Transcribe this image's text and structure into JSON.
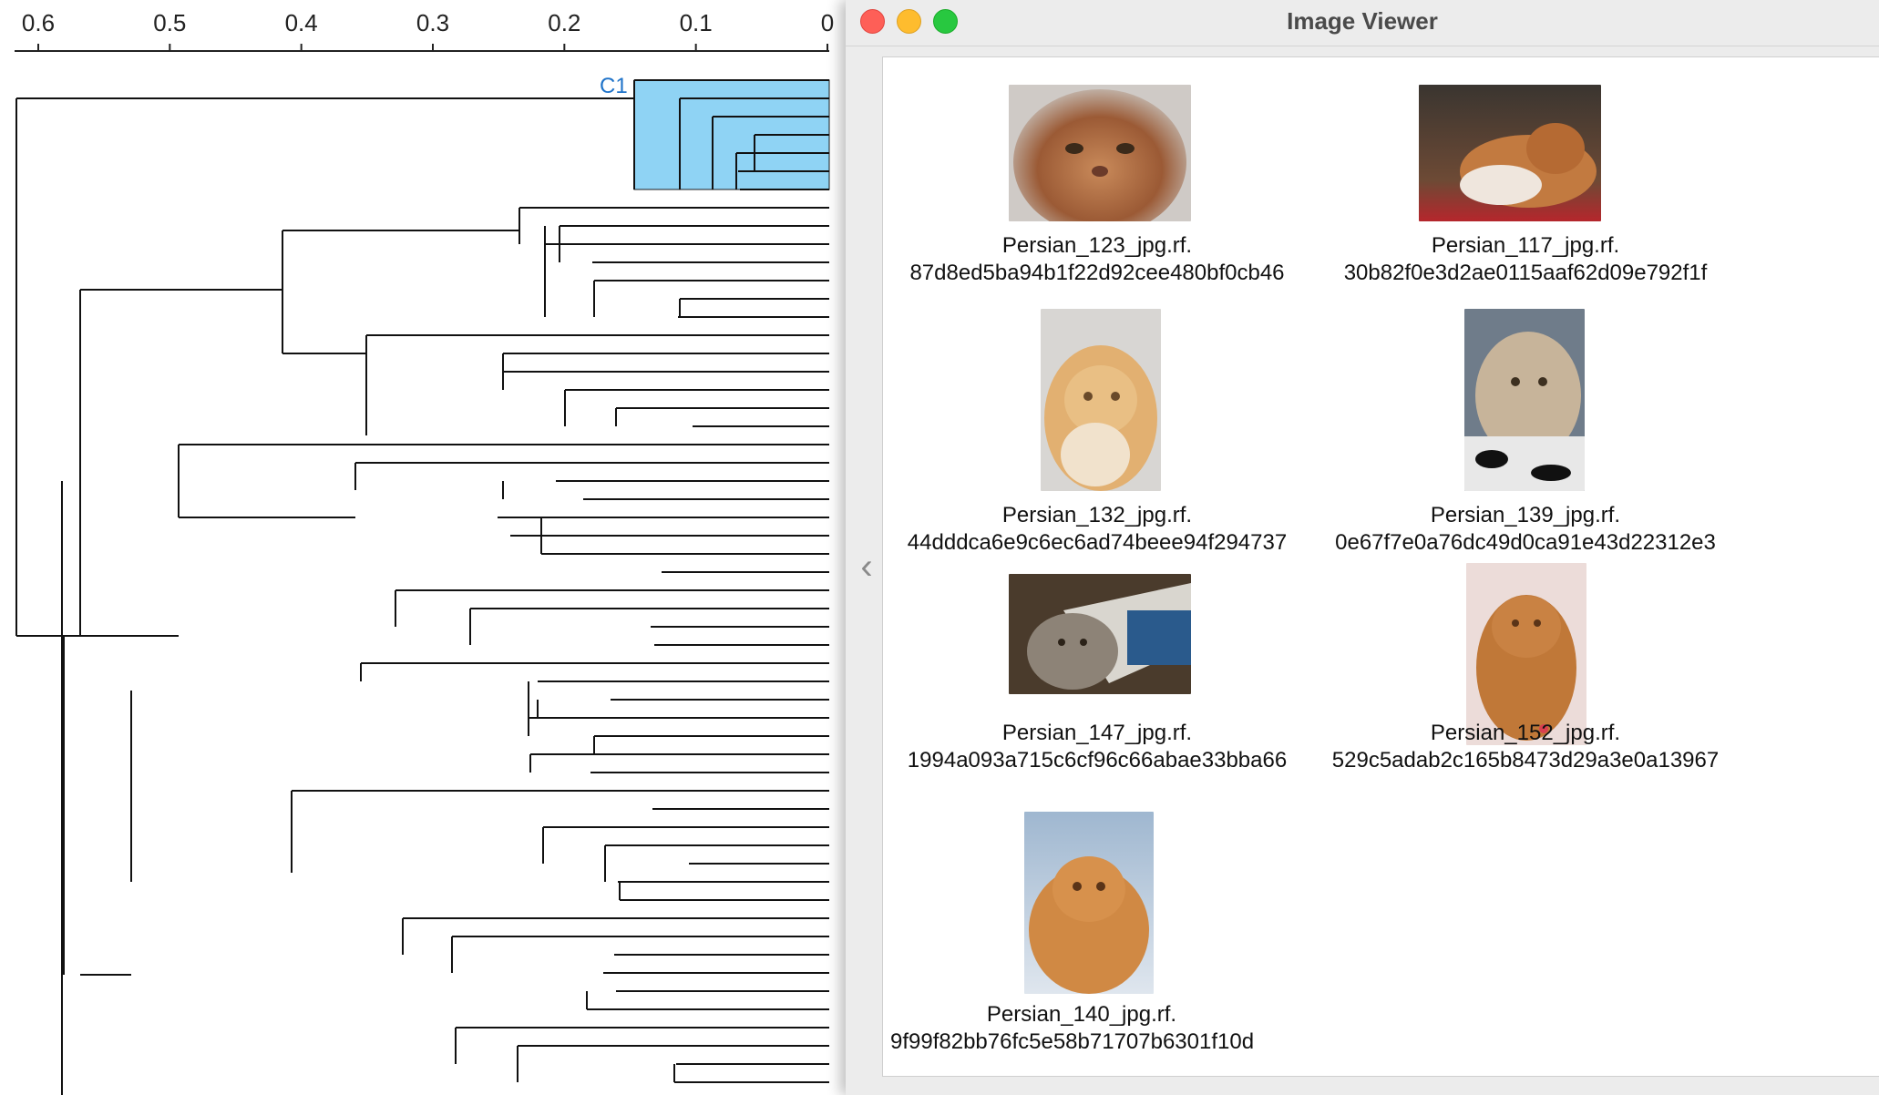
{
  "dendrogram": {
    "axis_ticks": [
      "0.6",
      "0.5",
      "0.4",
      "0.3",
      "0.2",
      "0.1",
      "0"
    ],
    "selected_cluster_label": "C1",
    "cluster_highlight_color": "#8fd3f4",
    "cluster_label_color": "#1f73c9"
  },
  "viewer": {
    "title": "Image Viewer",
    "collapse_icon": "chevron-left-icon",
    "images": [
      {
        "name_line1": "Persian_123_jpg.rf.",
        "name_line2": "87d8ed5ba94b1f22d92cee480bf0cb46"
      },
      {
        "name_line1": "Persian_117_jpg.rf.",
        "name_line2": "30b82f0e3d2ae0115aaf62d09e792f1f"
      },
      {
        "name_line1": "Persian_132_jpg.rf.",
        "name_line2": "44dddca6e9c6ec6ad74beee94f294737"
      },
      {
        "name_line1": "Persian_139_jpg.rf.",
        "name_line2": "0e67f7e0a76dc49d0ca91e43d22312e3"
      },
      {
        "name_line1": "Persian_147_jpg.rf.",
        "name_line2": "1994a093a715c6cf96c66abae33bba66"
      },
      {
        "name_line1": "Persian_152_jpg.rf.",
        "name_line2": "529c5adab2c165b8473d29a3e0a13967"
      },
      {
        "name_line1": "Persian_140_jpg.rf.",
        "name_line2": "9f99f82bb76fc5e58b71707b6301f10d"
      }
    ]
  }
}
